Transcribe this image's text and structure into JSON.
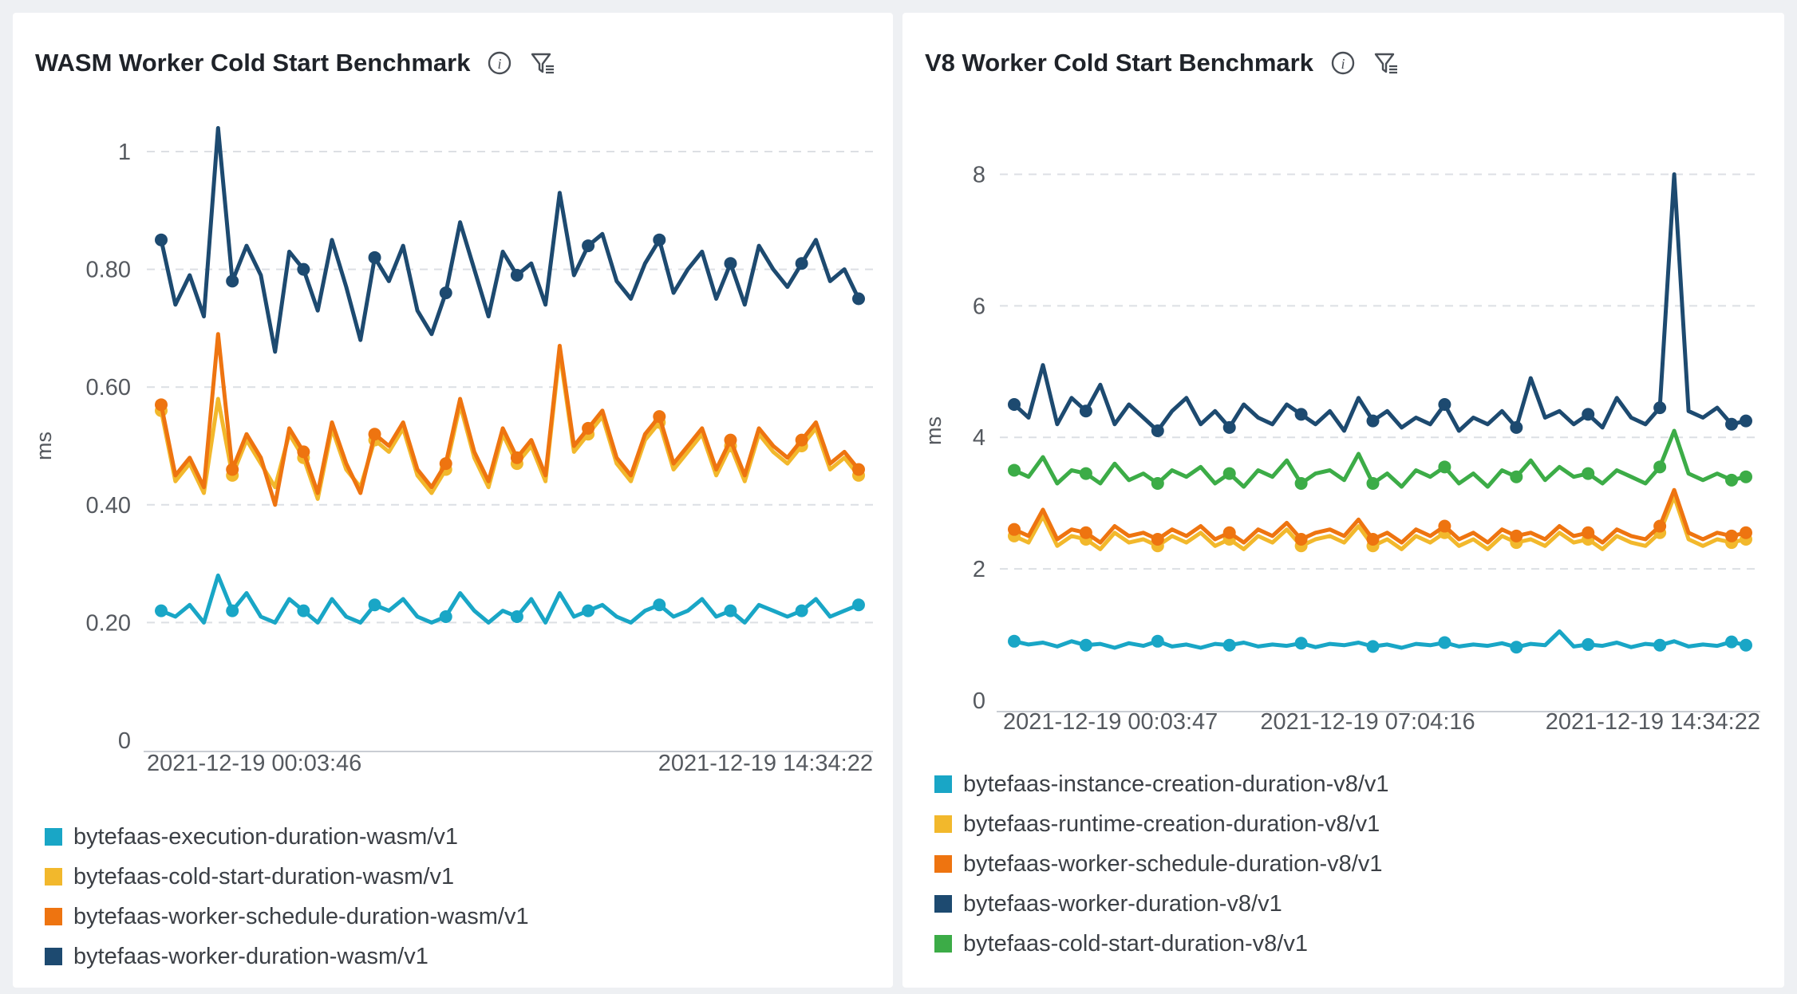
{
  "panels": [
    {
      "title": "WASM Worker Cold Start Benchmark",
      "info_icon": "info-icon",
      "filter_icon": "filter-icon",
      "chart_data": {
        "type": "line",
        "title": "WASM Worker Cold Start Benchmark",
        "ylabel": "ms",
        "xlabel": "",
        "ylim": [
          0,
          1.0
        ],
        "yticks": [
          0,
          0.2,
          0.4,
          0.6,
          0.8,
          1
        ],
        "ytick_labels": [
          "0",
          "0.20",
          "0.40",
          "0.60",
          "0.80",
          "1"
        ],
        "x_range": [
          "2021-12-19 00:03:46",
          "2021-12-19 14:34:22"
        ],
        "xtick_labels": [
          "2021-12-19 00:03:46",
          "2021-12-19 14:34:22"
        ],
        "grid": true,
        "legend_position": "bottom",
        "series": [
          {
            "name": "bytefaas-execution-duration-wasm/v1",
            "color": "#19a6c6",
            "values": [
              0.22,
              0.21,
              0.23,
              0.2,
              0.28,
              0.22,
              0.25,
              0.21,
              0.2,
              0.24,
              0.22,
              0.2,
              0.24,
              0.21,
              0.2,
              0.23,
              0.22,
              0.24,
              0.21,
              0.2,
              0.21,
              0.25,
              0.22,
              0.2,
              0.22,
              0.21,
              0.24,
              0.2,
              0.25,
              0.21,
              0.22,
              0.23,
              0.21,
              0.2,
              0.22,
              0.23,
              0.21,
              0.22,
              0.24,
              0.21,
              0.22,
              0.2,
              0.23,
              0.22,
              0.21,
              0.22,
              0.24,
              0.21,
              0.22,
              0.23
            ]
          },
          {
            "name": "bytefaas-cold-start-duration-wasm/v1",
            "color": "#f2b82c",
            "values": [
              0.56,
              0.44,
              0.47,
              0.42,
              0.58,
              0.45,
              0.51,
              0.47,
              0.43,
              0.52,
              0.48,
              0.41,
              0.53,
              0.46,
              0.43,
              0.51,
              0.49,
              0.53,
              0.45,
              0.42,
              0.46,
              0.57,
              0.48,
              0.43,
              0.52,
              0.47,
              0.5,
              0.44,
              0.66,
              0.49,
              0.52,
              0.55,
              0.47,
              0.44,
              0.51,
              0.54,
              0.46,
              0.49,
              0.52,
              0.45,
              0.5,
              0.44,
              0.52,
              0.49,
              0.47,
              0.5,
              0.53,
              0.46,
              0.48,
              0.45
            ]
          },
          {
            "name": "bytefaas-worker-schedule-duration-wasm/v1",
            "color": "#ee7410",
            "values": [
              0.57,
              0.45,
              0.48,
              0.43,
              0.69,
              0.46,
              0.52,
              0.48,
              0.4,
              0.53,
              0.49,
              0.42,
              0.54,
              0.47,
              0.42,
              0.52,
              0.5,
              0.54,
              0.46,
              0.43,
              0.47,
              0.58,
              0.49,
              0.44,
              0.53,
              0.48,
              0.51,
              0.45,
              0.67,
              0.5,
              0.53,
              0.56,
              0.48,
              0.45,
              0.52,
              0.55,
              0.47,
              0.5,
              0.53,
              0.46,
              0.51,
              0.45,
              0.53,
              0.5,
              0.48,
              0.51,
              0.54,
              0.47,
              0.49,
              0.46
            ]
          },
          {
            "name": "bytefaas-worker-duration-wasm/v1",
            "color": "#1d4a70",
            "values": [
              0.85,
              0.74,
              0.79,
              0.72,
              1.04,
              0.78,
              0.84,
              0.79,
              0.66,
              0.83,
              0.8,
              0.73,
              0.85,
              0.77,
              0.68,
              0.82,
              0.78,
              0.84,
              0.73,
              0.69,
              0.76,
              0.88,
              0.8,
              0.72,
              0.83,
              0.79,
              0.81,
              0.74,
              0.93,
              0.79,
              0.84,
              0.86,
              0.78,
              0.75,
              0.81,
              0.85,
              0.76,
              0.8,
              0.83,
              0.75,
              0.81,
              0.74,
              0.84,
              0.8,
              0.77,
              0.81,
              0.85,
              0.78,
              0.8,
              0.75
            ]
          }
        ]
      }
    },
    {
      "title": "V8 Worker Cold Start Benchmark",
      "info_icon": "info-icon",
      "filter_icon": "filter-icon",
      "chart_data": {
        "type": "line",
        "title": "V8 Worker Cold Start Benchmark",
        "ylabel": "ms",
        "xlabel": "",
        "ylim": [
          0,
          8.2
        ],
        "yticks": [
          0,
          2,
          4,
          6,
          8
        ],
        "ytick_labels": [
          "0",
          "2",
          "4",
          "6",
          "8"
        ],
        "x_range": [
          "2021-12-19 00:03:47",
          "2021-12-19 14:34:22"
        ],
        "xtick_labels": [
          "2021-12-19 00:03:47",
          "2021-12-19 07:04:16",
          "2021-12-19 14:34:22"
        ],
        "grid": true,
        "legend_position": "bottom",
        "series": [
          {
            "name": "bytefaas-instance-creation-duration-v8/v1",
            "color": "#19a6c6",
            "values": [
              0.9,
              0.85,
              0.88,
              0.82,
              0.9,
              0.84,
              0.86,
              0.8,
              0.87,
              0.83,
              0.9,
              0.82,
              0.85,
              0.8,
              0.86,
              0.84,
              0.88,
              0.82,
              0.85,
              0.83,
              0.87,
              0.81,
              0.86,
              0.84,
              0.88,
              0.82,
              0.85,
              0.8,
              0.86,
              0.84,
              0.88,
              0.82,
              0.85,
              0.83,
              0.87,
              0.81,
              0.86,
              0.84,
              1.05,
              0.82,
              0.85,
              0.83,
              0.88,
              0.81,
              0.86,
              0.84,
              0.9,
              0.82,
              0.85,
              0.83,
              0.89,
              0.84
            ]
          },
          {
            "name": "bytefaas-runtime-creation-duration-v8/v1",
            "color": "#f2b82c",
            "values": [
              2.5,
              2.4,
              2.8,
              2.35,
              2.5,
              2.45,
              2.3,
              2.55,
              2.4,
              2.45,
              2.35,
              2.5,
              2.4,
              2.55,
              2.35,
              2.45,
              2.3,
              2.5,
              2.4,
              2.6,
              2.35,
              2.45,
              2.5,
              2.4,
              2.65,
              2.35,
              2.45,
              2.3,
              2.5,
              2.4,
              2.55,
              2.35,
              2.45,
              2.3,
              2.5,
              2.4,
              2.45,
              2.35,
              2.55,
              2.4,
              2.45,
              2.3,
              2.5,
              2.4,
              2.35,
              2.55,
              3.1,
              2.45,
              2.35,
              2.45,
              2.4,
              2.45
            ]
          },
          {
            "name": "bytefaas-worker-schedule-duration-v8/v1",
            "color": "#ee7410",
            "values": [
              2.6,
              2.5,
              2.9,
              2.45,
              2.6,
              2.55,
              2.4,
              2.65,
              2.5,
              2.55,
              2.45,
              2.6,
              2.5,
              2.65,
              2.45,
              2.55,
              2.4,
              2.6,
              2.5,
              2.7,
              2.45,
              2.55,
              2.6,
              2.5,
              2.75,
              2.45,
              2.55,
              2.4,
              2.6,
              2.5,
              2.65,
              2.45,
              2.55,
              2.4,
              2.6,
              2.5,
              2.55,
              2.45,
              2.65,
              2.5,
              2.55,
              2.4,
              2.6,
              2.5,
              2.45,
              2.65,
              3.2,
              2.55,
              2.45,
              2.55,
              2.5,
              2.55
            ]
          },
          {
            "name": "bytefaas-worker-duration-v8/v1",
            "color": "#1d4a70",
            "values": [
              4.5,
              4.3,
              5.1,
              4.2,
              4.6,
              4.4,
              4.8,
              4.2,
              4.5,
              4.3,
              4.1,
              4.4,
              4.6,
              4.2,
              4.4,
              4.15,
              4.5,
              4.3,
              4.2,
              4.5,
              4.35,
              4.2,
              4.4,
              4.1,
              4.6,
              4.25,
              4.4,
              4.15,
              4.3,
              4.2,
              4.5,
              4.1,
              4.3,
              4.2,
              4.4,
              4.15,
              4.9,
              4.3,
              4.4,
              4.2,
              4.35,
              4.15,
              4.6,
              4.3,
              4.2,
              4.45,
              8.0,
              4.4,
              4.3,
              4.45,
              4.2,
              4.25
            ]
          },
          {
            "name": "bytefaas-cold-start-duration-v8/v1",
            "color": "#3cac47",
            "values": [
              3.5,
              3.4,
              3.7,
              3.3,
              3.5,
              3.45,
              3.3,
              3.6,
              3.35,
              3.45,
              3.3,
              3.5,
              3.4,
              3.55,
              3.3,
              3.45,
              3.25,
              3.5,
              3.4,
              3.65,
              3.3,
              3.45,
              3.5,
              3.35,
              3.75,
              3.3,
              3.45,
              3.25,
              3.5,
              3.4,
              3.55,
              3.3,
              3.45,
              3.25,
              3.5,
              3.4,
              3.65,
              3.35,
              3.55,
              3.4,
              3.45,
              3.3,
              3.5,
              3.4,
              3.3,
              3.55,
              4.1,
              3.45,
              3.35,
              3.45,
              3.35,
              3.4
            ]
          }
        ]
      }
    }
  ]
}
